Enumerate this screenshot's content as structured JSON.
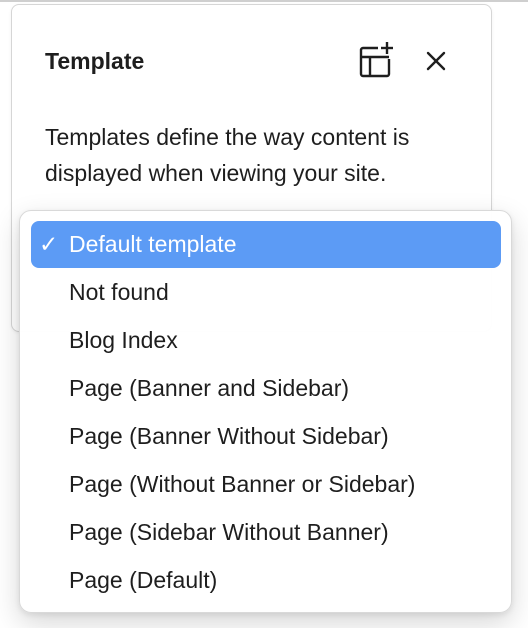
{
  "panel": {
    "title": "Template",
    "description": "Templates define the way content is displayed when viewing your site.",
    "new_template_icon": "layout-add-icon",
    "close_icon": "close-icon"
  },
  "dropdown": {
    "selected_index": 0,
    "check_glyph": "✓",
    "selected_color": "#5c9bf5",
    "options": [
      {
        "label": "Default template"
      },
      {
        "label": "Not found"
      },
      {
        "label": "Blog Index"
      },
      {
        "label": "Page (Banner and Sidebar)"
      },
      {
        "label": "Page (Banner Without Sidebar)"
      },
      {
        "label": "Page (Without Banner or Sidebar)"
      },
      {
        "label": "Page (Sidebar Without Banner)"
      },
      {
        "label": "Page (Default)"
      }
    ]
  }
}
